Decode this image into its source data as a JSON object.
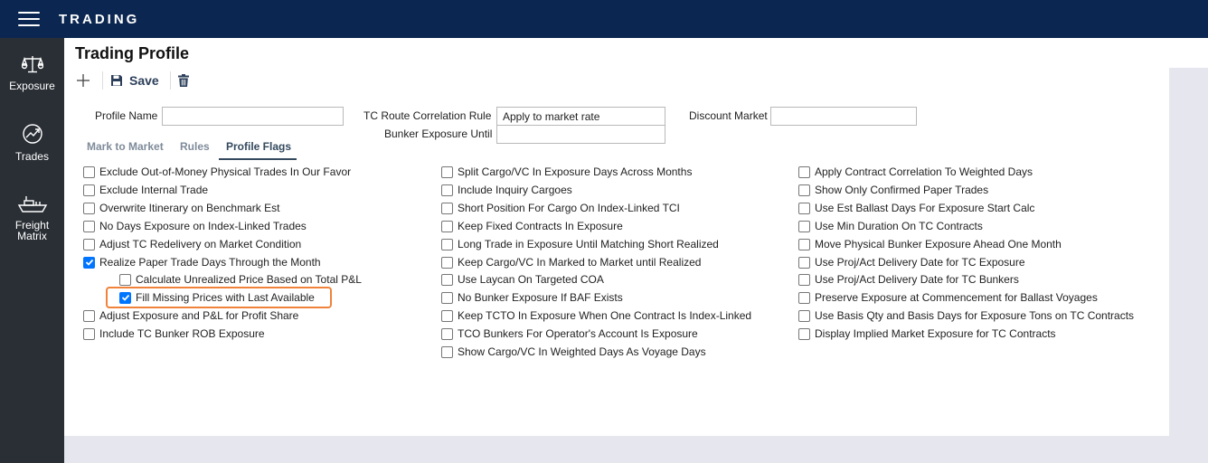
{
  "app": {
    "title": "TRADING"
  },
  "sidenav": {
    "items": [
      {
        "label": "Exposure",
        "icon": "scale-icon"
      },
      {
        "label": "Trades",
        "icon": "trend-chart-icon"
      },
      {
        "label": "Freight Matrix",
        "icon": "ship-icon"
      }
    ]
  },
  "page": {
    "title": "Trading Profile"
  },
  "toolbar": {
    "save_label": "Save",
    "add_icon": "plus-icon",
    "save_icon": "floppy-disk-icon",
    "delete_icon": "trash-icon"
  },
  "form": {
    "profile_name_label": "Profile Name",
    "profile_name_value": "",
    "tc_route_label": "TC Route Correlation Rule",
    "tc_route_value": "Apply to market rate",
    "bunker_exposure_label": "Bunker Exposure Until",
    "bunker_exposure_value": "",
    "discount_market_label": "Discount Market",
    "discount_market_value": ""
  },
  "tabs": [
    {
      "label": "Mark to Market",
      "active": false
    },
    {
      "label": "Rules",
      "active": false
    },
    {
      "label": "Profile Flags",
      "active": true
    }
  ],
  "flags": {
    "col1": [
      {
        "label": "Exclude Out-of-Money Physical Trades In Our Favor",
        "checked": false
      },
      {
        "label": "Exclude Internal Trade",
        "checked": false
      },
      {
        "label": "Overwrite Itinerary on Benchmark Est",
        "checked": false
      },
      {
        "label": "No Days Exposure on Index-Linked Trades",
        "checked": false
      },
      {
        "label": "Adjust TC Redelivery on Market Condition",
        "checked": false
      },
      {
        "label": "Realize Paper Trade Days Through the Month",
        "checked": true
      },
      {
        "label": "Calculate Unrealized Price Based on Total P&L",
        "checked": false
      },
      {
        "label": "Fill Missing Prices with Last Available",
        "checked": true
      },
      {
        "label": "Adjust Exposure and P&L for Profit Share",
        "checked": false
      },
      {
        "label": "Include TC Bunker ROB Exposure",
        "checked": false
      }
    ],
    "col2": [
      {
        "label": "Split Cargo/VC In Exposure Days Across Months",
        "checked": false
      },
      {
        "label": "Include Inquiry Cargoes",
        "checked": false
      },
      {
        "label": "Short Position For Cargo On Index-Linked TCI",
        "checked": false
      },
      {
        "label": "Keep Fixed Contracts In Exposure",
        "checked": false
      },
      {
        "label": "Long Trade in Exposure Until Matching Short Realized",
        "checked": false
      },
      {
        "label": "Keep Cargo/VC In Marked to Market until Realized",
        "checked": false
      },
      {
        "label": "Use Laycan On Targeted COA",
        "checked": false
      },
      {
        "label": "No Bunker Exposure If BAF Exists",
        "checked": false
      },
      {
        "label": "Keep TCTO In Exposure When One Contract Is Index-Linked",
        "checked": false
      },
      {
        "label": "TCO Bunkers For Operator's Account Is Exposure",
        "checked": false
      },
      {
        "label": "Show Cargo/VC In Weighted Days As Voyage Days",
        "checked": false
      }
    ],
    "col3": [
      {
        "label": "Apply Contract Correlation To Weighted Days",
        "checked": false
      },
      {
        "label": "Show Only Confirmed Paper Trades",
        "checked": false
      },
      {
        "label": "Use Est Ballast Days For Exposure Start Calc",
        "checked": false
      },
      {
        "label": "Use Min Duration On TC Contracts",
        "checked": false
      },
      {
        "label": "Move Physical Bunker Exposure Ahead One Month",
        "checked": false
      },
      {
        "label": "Use Proj/Act Delivery Date for TC Exposure",
        "checked": false
      },
      {
        "label": "Use Proj/Act Delivery Date for TC Bunkers",
        "checked": false
      },
      {
        "label": "Preserve Exposure at Commencement for Ballast Voyages",
        "checked": false
      },
      {
        "label": "Use Basis Qty and Basis Days for Exposure Tons on TC Contracts",
        "checked": false
      },
      {
        "label": "Display Implied Market Exposure for TC Contracts",
        "checked": false
      }
    ]
  },
  "colors": {
    "topbar": "#0b2650",
    "sidenav": "#2a2f35",
    "highlight": "#f0823a",
    "checkbox_checked": "#0075ff"
  }
}
